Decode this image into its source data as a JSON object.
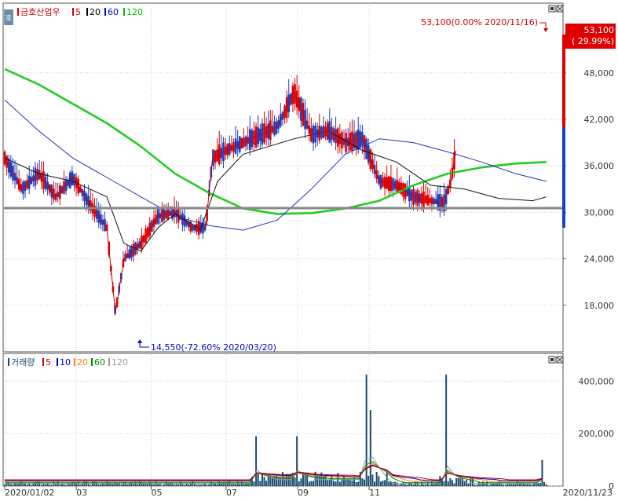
{
  "price_panel": {
    "legend": [
      {
        "label": "금호산업우",
        "color": "#cc0000"
      },
      {
        "label": "5",
        "color": "#cc0000"
      },
      {
        "label": "20",
        "color": "#000000"
      },
      {
        "label": "60",
        "color": "#0000cc"
      },
      {
        "label": "120",
        "color": "#00bb00"
      }
    ],
    "side_tab_label": "호",
    "current_price_label": "53,100",
    "current_change_label": "( 29.99%)",
    "high_annotation": "53,100(0.00% 2020/11/16)",
    "low_annotation": "14,550(-72.60% 2020/03/20)"
  },
  "volume_panel": {
    "legend": [
      {
        "label": "거래량",
        "color": "#1a4a6e"
      },
      {
        "label": "5",
        "color": "#cc0000"
      },
      {
        "label": "10",
        "color": "#0000cc"
      },
      {
        "label": "20",
        "color": "#ee8800"
      },
      {
        "label": "60",
        "color": "#008800"
      },
      {
        "label": "120",
        "color": "#999999"
      }
    ]
  },
  "x_axis_labels": [
    "2020/01/02",
    "03",
    "05",
    "07",
    "09",
    "11",
    "2020/11/23"
  ],
  "chart_data": [
    {
      "type": "candlestick",
      "title": "금호산업우",
      "x_range": [
        "2020/01/02",
        "2020/11/23"
      ],
      "y_ticks": [
        18000,
        24000,
        30000,
        36000,
        42000,
        48000
      ],
      "y_tick_labels": [
        "18,000",
        "24,000",
        "30,000",
        "36,000",
        "42,000",
        "48,000"
      ],
      "ylim": [
        12000,
        57000
      ],
      "moving_averages": [
        "5",
        "20",
        "60",
        "120"
      ],
      "reference_line": 31000,
      "series": [
        {
          "name": "120",
          "points": [
            [
              0,
              48500
            ],
            [
              20,
              46500
            ],
            [
              40,
              44000
            ],
            [
              60,
              41500
            ],
            [
              80,
              38500
            ],
            [
              100,
              35000
            ],
            [
              120,
              32500
            ],
            [
              140,
              30500
            ],
            [
              160,
              29800
            ],
            [
              180,
              29900
            ],
            [
              200,
              30500
            ],
            [
              220,
              31500
            ],
            [
              240,
              33500
            ],
            [
              260,
              35000
            ],
            [
              280,
              35800
            ],
            [
              300,
              36300
            ],
            [
              318,
              36500
            ]
          ]
        },
        {
          "name": "60",
          "points": [
            [
              0,
              44500
            ],
            [
              20,
              40500
            ],
            [
              40,
              37000
            ],
            [
              60,
              34500
            ],
            [
              80,
              32000
            ],
            [
              100,
              29500
            ],
            [
              120,
              28300
            ],
            [
              140,
              27700
            ],
            [
              160,
              29000
            ],
            [
              180,
              33000
            ],
            [
              200,
              37500
            ],
            [
              220,
              39500
            ],
            [
              240,
              39000
            ],
            [
              260,
              37800
            ],
            [
              280,
              36500
            ],
            [
              300,
              35000
            ],
            [
              318,
              34000
            ]
          ]
        },
        {
          "name": "20",
          "points": [
            [
              0,
              37000
            ],
            [
              20,
              35000
            ],
            [
              40,
              34000
            ],
            [
              60,
              32000
            ],
            [
              70,
              26000
            ],
            [
              80,
              25000
            ],
            [
              90,
              28000
            ],
            [
              100,
              29800
            ],
            [
              115,
              27800
            ],
            [
              125,
              34000
            ],
            [
              140,
              37500
            ],
            [
              170,
              39500
            ],
            [
              190,
              40500
            ],
            [
              210,
              38000
            ],
            [
              230,
              36500
            ],
            [
              250,
              33500
            ],
            [
              270,
              33000
            ],
            [
              290,
              31800
            ],
            [
              310,
              31500
            ],
            [
              318,
              32000
            ]
          ]
        },
        {
          "name": "5",
          "points": [
            [
              0,
              37000
            ],
            [
              10,
              33000
            ],
            [
              20,
              35000
            ],
            [
              30,
              32000
            ],
            [
              40,
              34500
            ],
            [
              50,
              31000
            ],
            [
              60,
              28000
            ],
            [
              65,
              17000
            ],
            [
              70,
              24000
            ],
            [
              80,
              26000
            ],
            [
              90,
              29500
            ],
            [
              100,
              30000
            ],
            [
              110,
              28000
            ],
            [
              118,
              28000
            ],
            [
              122,
              37000
            ],
            [
              130,
              38000
            ],
            [
              140,
              39000
            ],
            [
              160,
              41000
            ],
            [
              170,
              45500
            ],
            [
              180,
              40000
            ],
            [
              190,
              40500
            ],
            [
              200,
              39000
            ],
            [
              210,
              39500
            ],
            [
              220,
              34000
            ],
            [
              230,
              33500
            ],
            [
              240,
              32000
            ],
            [
              250,
              31500
            ],
            [
              258,
              31200
            ],
            [
              262,
              34000
            ],
            [
              265,
              38000
            ]
          ]
        }
      ],
      "annotations": [
        {
          "label": "53,100(0.00% 2020/11/16)",
          "x": "2020/11/16",
          "y": 53100
        },
        {
          "label": "14,550(-72.60% 2020/03/20)",
          "x": "2020/03/20",
          "y": 14550
        }
      ]
    },
    {
      "type": "bar",
      "title": "거래량",
      "y_ticks": [
        0,
        200000,
        400000
      ],
      "y_tick_labels": [
        "0",
        "200,000",
        "400,000"
      ],
      "ylim": [
        0,
        470000
      ],
      "moving_averages": [
        "5",
        "10",
        "20",
        "60",
        "120"
      ],
      "spikes": [
        {
          "x_day": 148,
          "volume": 190000
        },
        {
          "x_day": 172,
          "volume": 190000
        },
        {
          "x_day": 212,
          "volume": 425000
        },
        {
          "x_day": 215,
          "volume": 290000
        },
        {
          "x_day": 259,
          "volume": 425000
        },
        {
          "x_day": 316,
          "volume": 100000
        }
      ]
    }
  ]
}
